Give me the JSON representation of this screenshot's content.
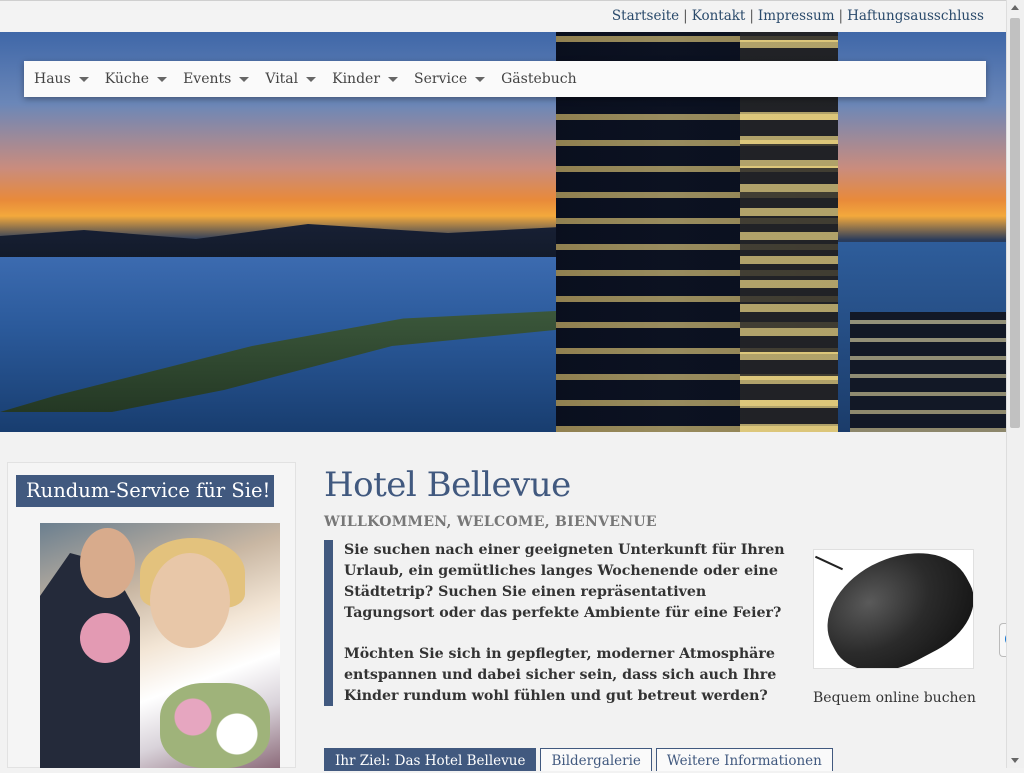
{
  "toplinks": [
    {
      "label": "Startseite"
    },
    {
      "label": "Kontakt"
    },
    {
      "label": "Impressum"
    },
    {
      "label": "Haftungsausschluss"
    }
  ],
  "toplinks_separator": "|",
  "nav": [
    {
      "label": "Haus",
      "has_dropdown": true
    },
    {
      "label": "Küche",
      "has_dropdown": true
    },
    {
      "label": "Events",
      "has_dropdown": true
    },
    {
      "label": "Vital",
      "has_dropdown": true
    },
    {
      "label": "Kinder",
      "has_dropdown": true
    },
    {
      "label": "Service",
      "has_dropdown": true
    },
    {
      "label": "Gästebuch",
      "has_dropdown": false
    }
  ],
  "sidebar": {
    "title": "Rundum-Service für Sie!"
  },
  "main": {
    "heading": "Hotel Bellevue",
    "subheading": "WILLKOMMEN, WELCOME, BIENVENUE",
    "paragraphs": [
      "Sie suchen nach einer geeigneten Unterkunft für Ihren Urlaub, ein gemütliches langes Wochenende oder eine Städtetrip? Suchen Sie einen repräsentativen Tagungsort oder das perfekte Ambiente für eine Feier?",
      "Möchten Sie sich in gepflegter, moderner Atmosphäre entspannen und dabei sicher sein, dass sich auch Ihre Kinder rundum wohl fühlen und gut betreut werden?"
    ],
    "booking_caption": "Bequem online buchen",
    "tabs": [
      {
        "label": "Ihr Ziel: Das Hotel Bellevue",
        "active": true
      },
      {
        "label": "Bildergalerie",
        "active": false
      },
      {
        "label": "Weitere Informationen",
        "active": false
      }
    ]
  },
  "colors": {
    "accent": "#41597f",
    "link": "#2a4a6b"
  },
  "icons": {
    "nav_dropdown": "caret-down-icon",
    "remote_support": "teamviewer-icon"
  }
}
